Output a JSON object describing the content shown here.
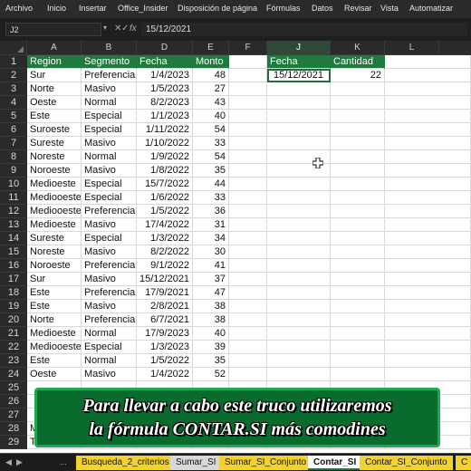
{
  "menu": [
    "Archivo",
    "Inicio",
    "Insertar",
    "Office_Insider",
    "Disposición de página",
    "Fórmulas",
    "Datos",
    "Revisar",
    "Vista",
    "Automatizar"
  ],
  "formula_bar": {
    "name_box": "J2",
    "cancel_symbol": "✕",
    "enter_symbol": "✓",
    "fx_symbol": "fx",
    "content": "15/12/2021"
  },
  "columns": [
    "A",
    "B",
    "D",
    "E",
    "F",
    "J",
    "K",
    "L"
  ],
  "headers": {
    "region": "Region",
    "segmento": "Segmento",
    "fecha": "Fecha",
    "monto": "Monto",
    "criteria_fecha": "Fecha",
    "criteria_cantidad": "Cantidad"
  },
  "criteria": {
    "fecha": "15/12/2021",
    "cantidad": "22"
  },
  "rows": [
    {
      "n": "3",
      "region": "Norte",
      "segmento": "Masivo",
      "fecha": "1/5/2023",
      "monto": "27"
    },
    {
      "n": "4",
      "region": "Oeste",
      "segmento": "Normal",
      "fecha": "8/2/2023",
      "monto": "43"
    },
    {
      "n": "5",
      "region": "Este",
      "segmento": "Especial",
      "fecha": "1/1/2023",
      "monto": "40"
    },
    {
      "n": "6",
      "region": "Suroeste",
      "segmento": "Especial",
      "fecha": "1/11/2022",
      "monto": "54"
    },
    {
      "n": "7",
      "region": "Sureste",
      "segmento": "Masivo",
      "fecha": "1/10/2022",
      "monto": "33"
    },
    {
      "n": "8",
      "region": "Noreste",
      "segmento": "Normal",
      "fecha": "1/9/2022",
      "monto": "54"
    },
    {
      "n": "9",
      "region": "Noroeste",
      "segmento": "Masivo",
      "fecha": "1/8/2022",
      "monto": "35"
    },
    {
      "n": "10",
      "region": "Medioeste",
      "segmento": "Especial",
      "fecha": "15/7/2022",
      "monto": "44"
    },
    {
      "n": "11",
      "region": "Mediooeste",
      "segmento": "Especial",
      "fecha": "1/6/2022",
      "monto": "33"
    },
    {
      "n": "12",
      "region": "Mediooeste",
      "segmento": "Preferencial",
      "fecha": "1/5/2022",
      "monto": "36"
    },
    {
      "n": "13",
      "region": "Medioeste",
      "segmento": "Masivo",
      "fecha": "17/4/2022",
      "monto": "31"
    },
    {
      "n": "14",
      "region": "Sureste",
      "segmento": "Especial",
      "fecha": "1/3/2022",
      "monto": "34"
    },
    {
      "n": "15",
      "region": "Noreste",
      "segmento": "Masivo",
      "fecha": "8/2/2022",
      "monto": "30"
    },
    {
      "n": "16",
      "region": "Noroeste",
      "segmento": "Preferencial",
      "fecha": "9/1/2022",
      "monto": "41"
    },
    {
      "n": "17",
      "region": "Sur",
      "segmento": "Masivo",
      "fecha": "15/12/2021",
      "monto": "37"
    },
    {
      "n": "18",
      "region": "Este",
      "segmento": "Preferencial",
      "fecha": "17/9/2021",
      "monto": "47"
    },
    {
      "n": "19",
      "region": "Este",
      "segmento": "Masivo",
      "fecha": "2/8/2021",
      "monto": "38"
    },
    {
      "n": "20",
      "region": "Norte",
      "segmento": "Preferencial",
      "fecha": "6/7/2021",
      "monto": "38"
    },
    {
      "n": "21",
      "region": "Medioeste",
      "segmento": "Normal",
      "fecha": "17/9/2023",
      "monto": "40"
    },
    {
      "n": "22",
      "region": "Mediooeste",
      "segmento": "Especial",
      "fecha": "1/3/2023",
      "monto": "39"
    },
    {
      "n": "23",
      "region": "Este",
      "segmento": "Normal",
      "fecha": "1/5/2022",
      "monto": "35"
    },
    {
      "n": "24",
      "region": "Oeste",
      "segmento": "Masivo",
      "fecha": "1/4/2022",
      "monto": "52"
    }
  ],
  "row2": {
    "n": "2",
    "region": "Sur",
    "segmento": "Preferencial",
    "fecha": "1/4/2023",
    "monto": "48"
  },
  "partial_rows": [
    {
      "n": "25",
      "region": "",
      "monto": ""
    },
    {
      "n": "26",
      "region": "",
      "monto": ""
    },
    {
      "n": "27",
      "region": "",
      "monto": ""
    },
    {
      "n": "28",
      "region": "Me",
      "monto": ""
    },
    {
      "n": "29",
      "region": "Total",
      "monto": ""
    }
  ],
  "caption": {
    "line1": "Para llevar a cabo este truco utilizaremos",
    "line2": "la fórmula CONTAR.SI más comodines"
  },
  "tabs": {
    "nav_prev": "◀",
    "nav_next": "▶",
    "more": "...",
    "items": [
      "Busqueda_2_criterios",
      "Sumar_SI",
      "Sumar_SI_Conjunto",
      "Contar_SI",
      "Contar_SI_Conjunto",
      "C"
    ]
  },
  "colors": {
    "header_green": "#1e7a3d",
    "tab_yellow": "#f2d22b",
    "caption_green": "#0a6b2e"
  }
}
